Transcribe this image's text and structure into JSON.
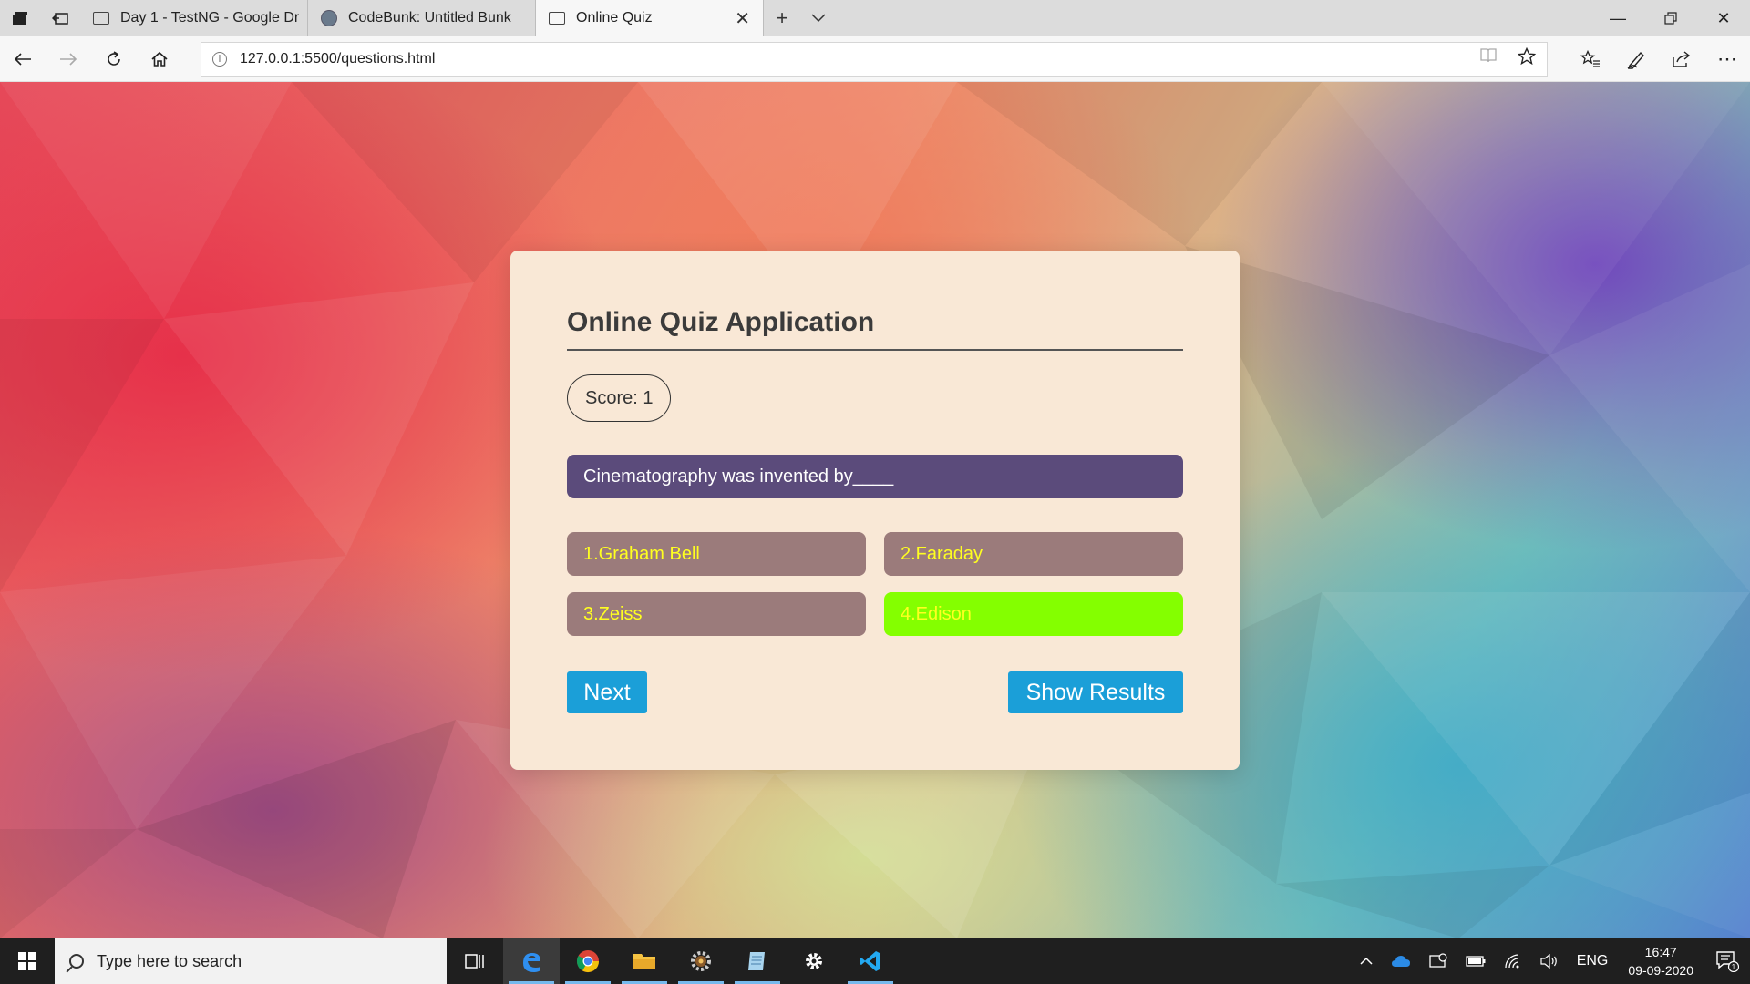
{
  "browser": {
    "tabs": [
      {
        "title": "Day 1 - TestNG - Google Dr",
        "active": false
      },
      {
        "title": "CodeBunk: Untitled Bunk",
        "active": false
      },
      {
        "title": "Online Quiz",
        "active": true
      }
    ],
    "url": "127.0.0.1:5500/questions.html"
  },
  "quiz": {
    "title": "Online Quiz Application",
    "score_label": "Score: 1",
    "question": "Cinematography was invented by____",
    "options": [
      {
        "label": "1.Graham Bell",
        "state": "default"
      },
      {
        "label": "2.Faraday",
        "state": "default"
      },
      {
        "label": "3.Zeiss",
        "state": "default"
      },
      {
        "label": "4.Edison",
        "state": "correct"
      }
    ],
    "next_label": "Next",
    "results_label": "Show Results",
    "colors": {
      "card_bg": "#f9e8d6",
      "question_bg": "#5b4b7b",
      "option_bg": "#9b7b7b",
      "option_text": "#ffff20",
      "correct_bg": "#84ff00",
      "button_bg": "#1b9fd8"
    }
  },
  "taskbar": {
    "search_placeholder": "Type here to search",
    "apps": [
      "task-view-icon",
      "edge-icon",
      "chrome-icon",
      "file-explorer-icon",
      "gear-app-icon",
      "notes-app-icon",
      "settings-icon",
      "vscode-icon"
    ],
    "language": "ENG",
    "time": "16:47",
    "date": "09-09-2020",
    "notification_count": "1"
  }
}
